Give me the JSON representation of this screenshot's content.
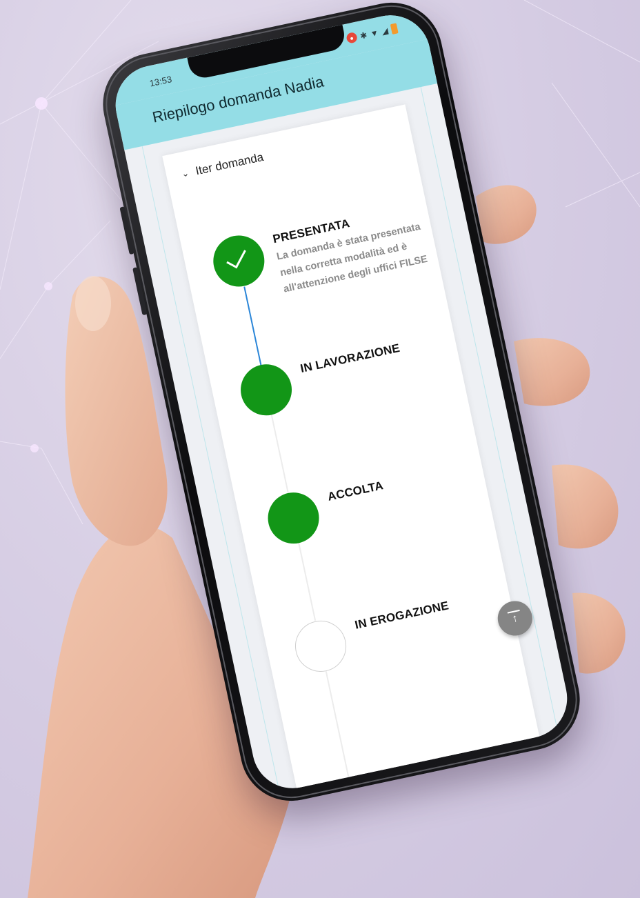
{
  "status_bar": {
    "time": "13:53",
    "icons": [
      "screen-record-icon",
      "bluetooth-icon",
      "wifi-icon",
      "signal-icon",
      "battery-icon"
    ]
  },
  "app": {
    "title": "Riepilogo domanda Nadia"
  },
  "section": {
    "title": "Iter domanda",
    "expanded": true
  },
  "steps": [
    {
      "label": "PRESENTATA",
      "status": "done",
      "description": "La domanda è stata presentata nella corretta modalità ed è all'attenzione degli uffici FILSE"
    },
    {
      "label": "IN LAVORAZIONE",
      "status": "done"
    },
    {
      "label": "ACCOLTA",
      "status": "done"
    },
    {
      "label": "IN EROGAZIONE",
      "status": "todo"
    }
  ],
  "colors": {
    "header": "#94dde6",
    "step_done": "#129617",
    "connector_active": "#2b86d8",
    "fab": "#858585",
    "background": "#d5cce3"
  },
  "fab": {
    "icon": "scroll-to-top-icon"
  }
}
